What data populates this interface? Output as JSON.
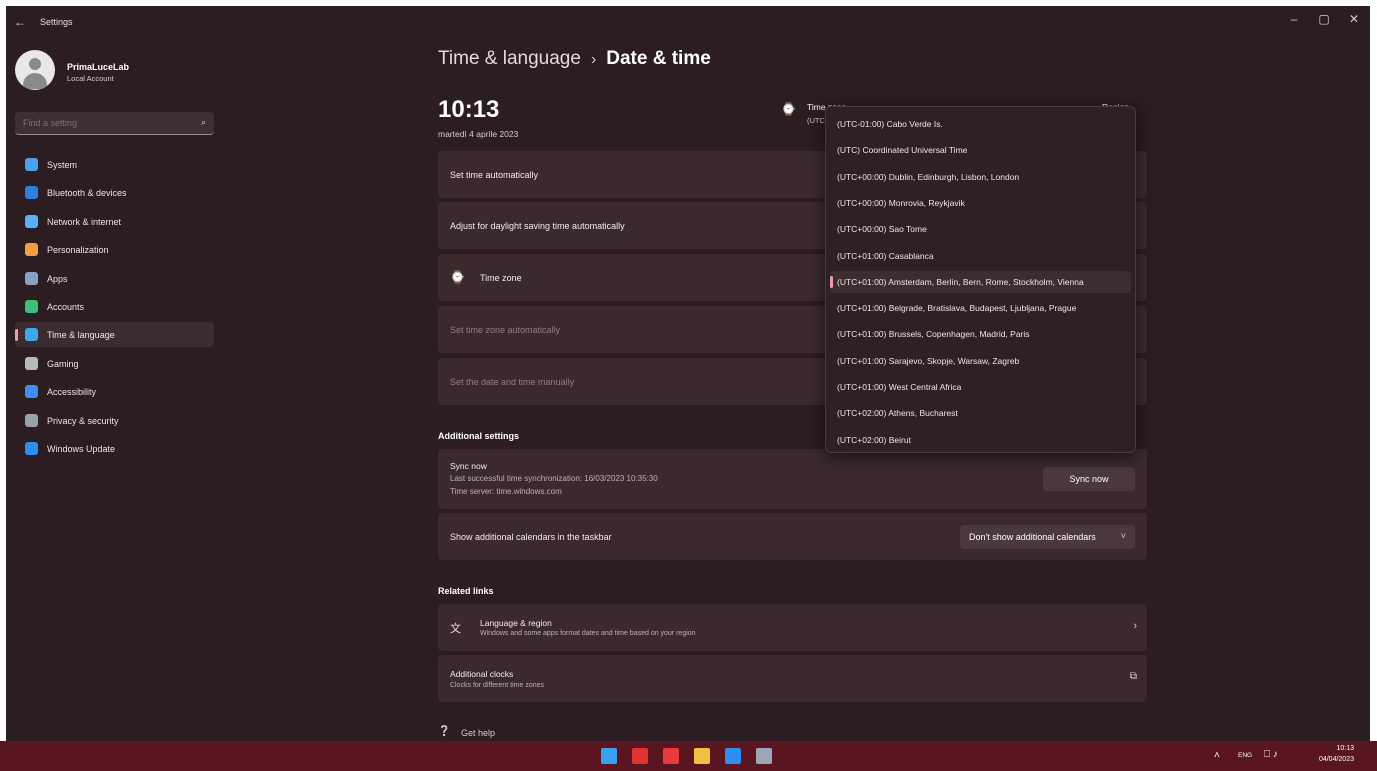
{
  "window": {
    "title": "Settings",
    "minimize": "–",
    "maximize": "▢",
    "close": "✕",
    "back": "←"
  },
  "user": {
    "name": "PrimaLuceLab",
    "account_type": "Local Account"
  },
  "search": {
    "placeholder": "Find a setting",
    "icon": "⌕"
  },
  "sidebar": {
    "items": [
      {
        "label": "System",
        "icon": "system-icon",
        "color": "#4aa3f0"
      },
      {
        "label": "Bluetooth & devices",
        "icon": "bluetooth-icon",
        "color": "#2f7fe0"
      },
      {
        "label": "Network & internet",
        "icon": "wifi-icon",
        "color": "#5bb0f5"
      },
      {
        "label": "Personalization",
        "icon": "brush-icon",
        "color": "#f0a040"
      },
      {
        "label": "Apps",
        "icon": "apps-icon",
        "color": "#8aa0c0"
      },
      {
        "label": "Accounts",
        "icon": "person-icon",
        "color": "#3fc07a"
      },
      {
        "label": "Time & language",
        "icon": "globe-clock-icon",
        "color": "#3fa8e8"
      },
      {
        "label": "Gaming",
        "icon": "gamepad-icon",
        "color": "#b8b8c0"
      },
      {
        "label": "Accessibility",
        "icon": "accessibility-icon",
        "color": "#3a8ff0"
      },
      {
        "label": "Privacy & security",
        "icon": "shield-icon",
        "color": "#9aa0a8"
      },
      {
        "label": "Windows Update",
        "icon": "update-icon",
        "color": "#2f8ff0"
      }
    ],
    "active_index": 6
  },
  "header": {
    "breadcrumb_parent": "Time & language",
    "separator": "›",
    "breadcrumb_current": "Date & time"
  },
  "clock": {
    "time": "10:13",
    "date": "martedì 4 aprile 2023"
  },
  "timezone_summary": {
    "label": "Time zone",
    "value": "(UTC",
    "region_label": "Region",
    "icon": "⌚"
  },
  "settings": {
    "set_time_auto": "Set time automatically",
    "dst_auto": "Adjust for daylight saving time automatically",
    "time_zone": "Time zone",
    "tz_auto": "Set time zone automatically",
    "manual": "Set the date and time manually"
  },
  "additional": {
    "section_title": "Additional settings",
    "sync_title": "Sync now",
    "sync_last": "Last successful time synchronization: 16/03/2023 10:35:30",
    "sync_server": "Time server: time.windows.com",
    "sync_button": "Sync now",
    "calendars_label": "Show additional calendars in the taskbar",
    "calendars_value": "Don't show additional calendars",
    "calendars_chevron": "˅"
  },
  "related": {
    "section_title": "Related links",
    "lang_title": "Language & region",
    "lang_sub": "Windows and some apps format dates and time based on your region",
    "clocks_title": "Additional clocks",
    "clocks_sub": "Clocks for different time zones",
    "chevron": "›",
    "external": "⧉"
  },
  "help": {
    "label": "Get help"
  },
  "timezone_options": [
    "(UTC-01:00) Cabo Verde Is.",
    "(UTC) Coordinated Universal Time",
    "(UTC+00:00) Dublin, Edinburgh, Lisbon, London",
    "(UTC+00:00) Monrovia, Reykjavik",
    "(UTC+00:00) Sao Tome",
    "(UTC+01:00) Casablanca",
    "(UTC+01:00) Amsterdam, Berlin, Bern, Rome, Stockholm, Vienna",
    "(UTC+01:00) Belgrade, Bratislava, Budapest, Ljubljana, Prague",
    "(UTC+01:00) Brussels, Copenhagen, Madrid, Paris",
    "(UTC+01:00) Sarajevo, Skopje, Warsaw, Zagreb",
    "(UTC+01:00) West Central Africa",
    "(UTC+02:00) Athens, Bucharest",
    "(UTC+02:00) Beirut"
  ],
  "timezone_selected_index": 6,
  "taskbar": {
    "apps": [
      {
        "name": "start-icon",
        "color": "#3a9ff0"
      },
      {
        "name": "xmind-icon",
        "color": "#e0352e"
      },
      {
        "name": "app-red-icon",
        "color": "#e83c3c"
      },
      {
        "name": "file-explorer-icon",
        "color": "#f0c040"
      },
      {
        "name": "vscode-icon",
        "color": "#2f8ff0"
      },
      {
        "name": "settings-icon",
        "color": "#9aa8b8"
      }
    ],
    "tray_chevron": "˄",
    "lang": "ENG",
    "tray_icons": "⎕ ♪",
    "time": "10:13",
    "date": "04/04/2023"
  },
  "colors": {
    "accent": "#f09ab0",
    "taskbar": "#5a1620",
    "window_bg": "#2b1d21"
  }
}
